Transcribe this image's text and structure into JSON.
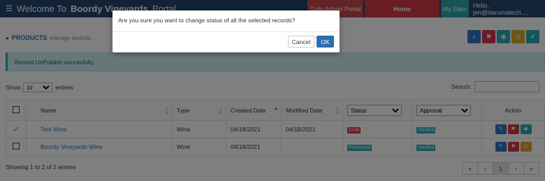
{
  "nav": {
    "brand_prefix": "Welcome To",
    "brand_bold": "Boordy Vineyards",
    "brand_suffix": "Portal",
    "admin_portal": "Goto Admin Portal",
    "home": "Home",
    "my_sites": "My Sites",
    "user_greeting": "Hello, jen@darumatech...."
  },
  "page": {
    "title": "PRODUCTS",
    "subtitle": "manage records...",
    "info_icon": "info-circle-icon",
    "tools": [
      {
        "name": "add",
        "icon": "plus-icon",
        "glyph": "+",
        "color": "#3075c8"
      },
      {
        "name": "delete",
        "icon": "times-icon",
        "glyph": "✖",
        "color": "#d9354a"
      },
      {
        "name": "publish",
        "icon": "eye-icon",
        "glyph": "◉",
        "color": "#2aaab8"
      },
      {
        "name": "unpublish",
        "icon": "eye-slash-icon",
        "glyph": "◎",
        "color": "#d8a429"
      },
      {
        "name": "approve",
        "icon": "check-icon",
        "glyph": "✔",
        "color": "#2aaab8"
      }
    ]
  },
  "alert": {
    "text": "Record UnPublish succesfully."
  },
  "controls": {
    "show_label": "Show",
    "entries_value": "10",
    "entries_label": "entries",
    "search_label": "Search:"
  },
  "table": {
    "headers": {
      "name": "Name",
      "type": "Type",
      "created": "Created Date",
      "modified": "Modified Date",
      "status_filter": "Status",
      "approval_filter": "Approval",
      "action": "Action"
    },
    "rows": [
      {
        "selected": true,
        "name": "Test Wine",
        "type": "Wine",
        "created": "04/18/2021",
        "modified": "04/18/2021",
        "status": "Draft",
        "approval": "Verified"
      },
      {
        "selected": false,
        "name": "Boordy Vineyards Wine",
        "type": "Wine",
        "created": "04/18/2021",
        "modified": "",
        "status": "Published",
        "approval": "Verified"
      }
    ]
  },
  "footer": {
    "info": "Showing 1 to 2 of 2 entries",
    "pages": [
      "«",
      "‹",
      "1",
      "›",
      "»"
    ]
  },
  "modal": {
    "message": "Are you sure you want to change status of all the selected records?",
    "cancel": "Cancel",
    "ok": "OK"
  }
}
